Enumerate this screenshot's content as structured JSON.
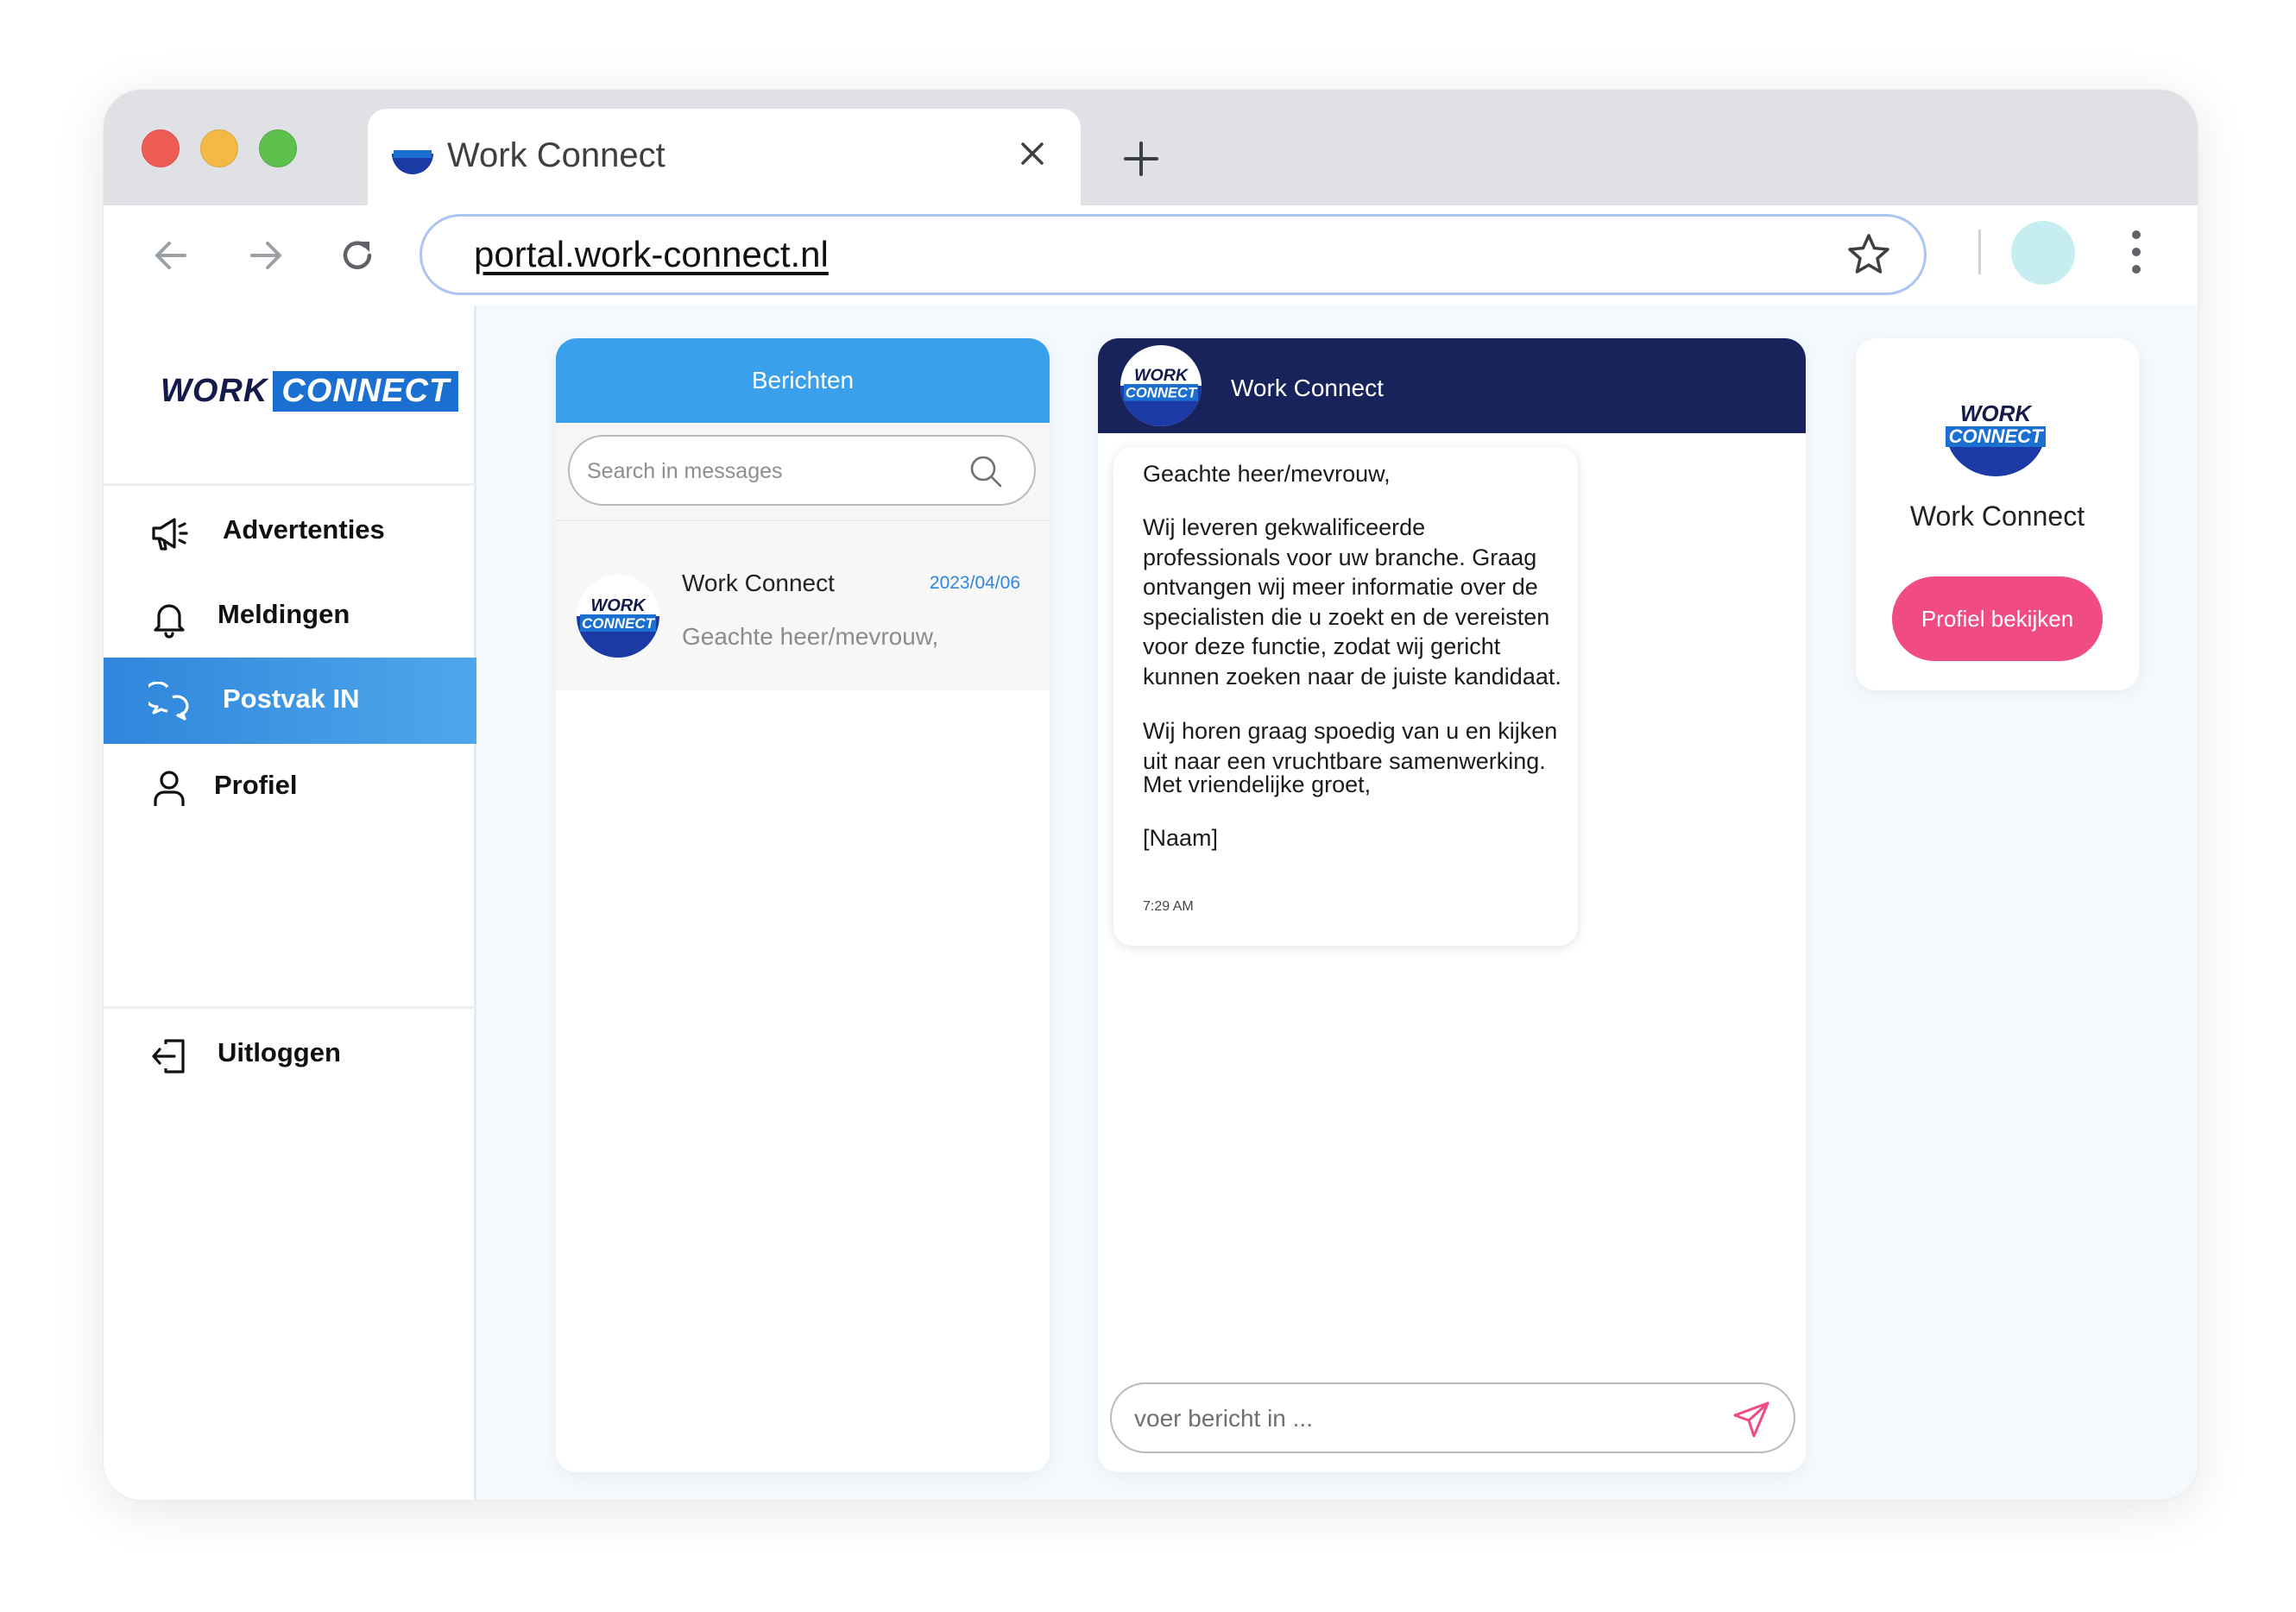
{
  "browser": {
    "tab_title": "Work Connect",
    "url": "portal.work-connect.nl"
  },
  "brand": {
    "work": "WORK",
    "connect": "CONNECT"
  },
  "sidebar": {
    "items": [
      {
        "label": "Advertenties",
        "icon": "megaphone-icon"
      },
      {
        "label": "Meldingen",
        "icon": "bell-icon"
      },
      {
        "label": "Postvak IN",
        "icon": "chat-bubbles-icon",
        "active": true
      },
      {
        "label": "Profiel",
        "icon": "user-icon"
      }
    ],
    "logout_label": "Uitloggen"
  },
  "messages_panel": {
    "header": "Berichten",
    "search_placeholder": "Search in messages",
    "conversations": [
      {
        "name": "Work Connect",
        "date": "2023/04/06",
        "preview": "Geachte heer/mevrouw,"
      }
    ]
  },
  "chat": {
    "contact_name": "Work Connect",
    "message": {
      "greeting": "Geachte heer/mevrouw,",
      "paragraph1": "Wij leveren gekwalificeerde professionals voor uw branche. Graag ontvangen wij meer informatie over de specialisten die u zoekt en de vereisten voor deze functie, zodat wij gericht kunnen zoeken naar de juiste kandidaat.",
      "paragraph2": "Wij horen graag spoedig van u en kijken uit naar een vruchtbare samenwerking.",
      "closing": "Met vriendelijke groet,",
      "signature": "[Naam]",
      "time": "7:29 AM"
    },
    "input_placeholder": "voer bericht in ..."
  },
  "profile_card": {
    "name": "Work Connect",
    "button_label": "Profiel bekijken"
  },
  "colors": {
    "accent_blue": "#3aa0ec",
    "navy": "#17235a",
    "pink": "#f04b83"
  }
}
